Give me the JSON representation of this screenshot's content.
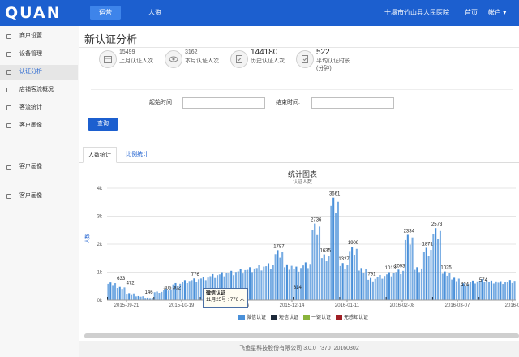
{
  "header": {
    "logo": "QUAN",
    "nav": [
      {
        "label": "运营",
        "active": true
      },
      {
        "label": "人资",
        "active": false
      }
    ],
    "hospital": "十堰市竹山县人民医院",
    "home": "首页",
    "account": "帐户 ▾"
  },
  "sidebar": {
    "items": [
      {
        "label": "商户设置",
        "active": false
      },
      {
        "label": "设备管理",
        "active": false
      },
      {
        "label": "认证分析",
        "active": true
      },
      {
        "label": "店铺客流概况",
        "active": false
      },
      {
        "label": "客流统计",
        "active": false
      },
      {
        "label": "客户画像",
        "active": false
      },
      {
        "label": "客户画像",
        "active": false
      },
      {
        "label": "客户画像",
        "active": false
      }
    ]
  },
  "page": {
    "title": "新认证分析"
  },
  "stats": [
    {
      "value": "15499",
      "label": "上月认证人次",
      "icon": "calendar-icon"
    },
    {
      "value": "3162",
      "label": "本月认证人次",
      "icon": "eye-icon"
    },
    {
      "value": "144180",
      "label": "历史认证人次",
      "icon": "clipboard-icon"
    },
    {
      "value": "522",
      "label": "平均认证时长(分钟)",
      "icon": "clipboard-icon"
    }
  ],
  "filters": {
    "start_label": "起始时间",
    "end_label": "结束时间:",
    "start_value": "",
    "end_value": "",
    "query_label": "查询"
  },
  "tabs": [
    {
      "label": "人数统计",
      "active": true
    },
    {
      "label": "比例统计",
      "active": false
    }
  ],
  "tooltip": {
    "title": "微信认证",
    "text": "11月25号 : 776 人"
  },
  "footer": {
    "text": "飞鱼星科技股份有限公司   3.0.0_r370_20160302"
  },
  "colors": {
    "brand": "#1c5fcf",
    "wechat": "#4a90d9",
    "sms": "#1e2a3a",
    "one_click": "#8ab43c",
    "no_auth": "#a01f24"
  },
  "chart_data": {
    "type": "bar",
    "title": "统计图表",
    "subtitle": "认证人数",
    "ylabel": "人数",
    "ylim": [
      0,
      4000
    ],
    "y_ticks": [
      "0k",
      "1k",
      "2k",
      "3k",
      "4k"
    ],
    "x_tick_labels": [
      "2015-09-21",
      "2015-10-19",
      "2015-11-16",
      "2015-12-14",
      "2016-01-11",
      "2016-02-08",
      "2016-03-07",
      "2016-0"
    ],
    "legend": [
      "微信认证",
      "短信认证",
      "一键认证",
      "无感知认证"
    ],
    "legend_position": "bottom",
    "grid": true,
    "series": [
      {
        "name": "微信认证",
        "values": [
          633,
          472,
          250,
          146,
          90,
          306,
          402,
          610,
          716,
          776,
          840,
          930,
          1000,
          1050,
          1120,
          1180,
          1250,
          1320,
          1787,
          1280,
          1200,
          1350,
          2736,
          1635,
          3661,
          1327,
          1909,
          1150,
          791,
          900,
          1000,
          1093,
          2334,
          1180,
          1871,
          2573,
          1025,
          800,
          600,
          700,
          750,
          700,
          680,
          720
        ]
      }
    ],
    "annotations": [
      "633",
      "472",
      "146",
      "306",
      "302",
      "776",
      "1787",
      "2736",
      "3661",
      "1635",
      "1327",
      "1909",
      "2334",
      "2573",
      "1871",
      "1093",
      "1025",
      "791",
      "314",
      "574",
      "424",
      "1013"
    ]
  }
}
